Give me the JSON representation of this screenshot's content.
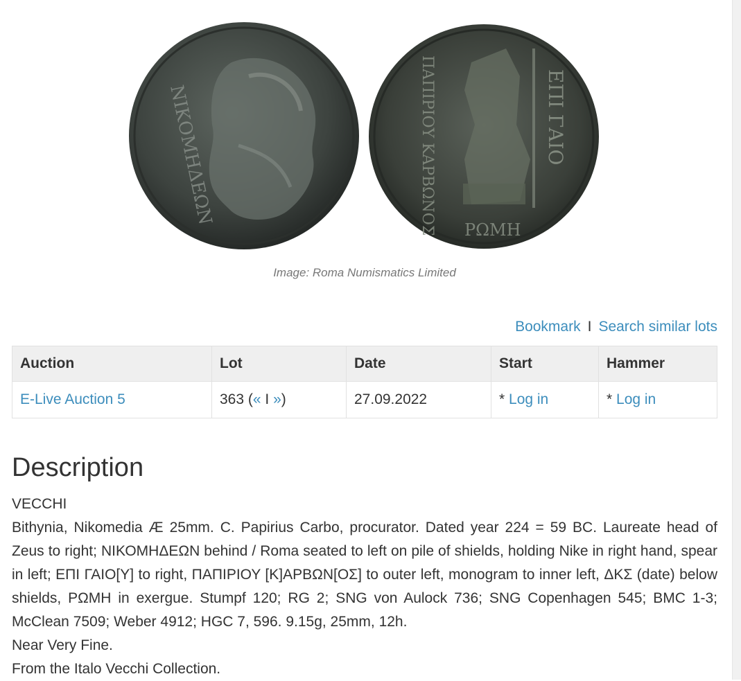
{
  "image": {
    "caption": "Image: Roma Numismatics Limited",
    "obverse_legend": "ΝΙΚΟΜΗΔΕΩΝ",
    "reverse_legend_right": "ΕΠΙ ΓΑΙΟ",
    "reverse_legend_left": "ΠΑΠΙΡΙΟΥ ΚΑΡΒΩΝΟΣ",
    "reverse_exergue": "ΡΩΜΗ"
  },
  "actions": {
    "bookmark": "Bookmark",
    "separator": "I",
    "search_similar": "Search similar lots"
  },
  "table": {
    "headers": [
      "Auction",
      "Lot",
      "Date",
      "Start",
      "Hammer"
    ],
    "row": {
      "auction": "E-Live Auction 5",
      "lot_number": "363",
      "lot_open": " (",
      "prev": "«",
      "lot_sep": " I ",
      "next": "»",
      "lot_close": ")",
      "date": "27.09.2022",
      "start_prefix": "* ",
      "start_login": "Log in",
      "hammer_prefix": "* ",
      "hammer_login": "Log in"
    }
  },
  "description": {
    "heading": "Description",
    "lines": [
      "VECCHI",
      "Bithynia, Nikomedia Æ 25mm. C. Papirius Carbo, procurator. Dated year 224 = 59 BC. Laureate head of Zeus to right; ΝΙΚΟΜΗΔΕΩΝ behind / Roma seated to left on pile of shields, holding Nike in right hand, spear in left; ΕΠΙ ΓΑΙΟ[Υ] to right, ΠΑΠΙΡΙΟΥ [Κ]ΑΡΒΩΝ[ΟΣ] to outer left, monogram to inner left, ΔΚΣ (date) below shields, ΡΩΜΗ in exergue. Stumpf 120; RG 2; SNG von Aulock 736; SNG Copenhagen 545; BMC 1-3; McClean 7509; Weber 4912; HGC 7, 596. 9.15g, 25mm, 12h.",
      "Near Very Fine.",
      "From the Italo Vecchi Collection."
    ]
  },
  "colors": {
    "link": "#3c8dbc",
    "text": "#333333",
    "header_bg": "#efefef"
  }
}
